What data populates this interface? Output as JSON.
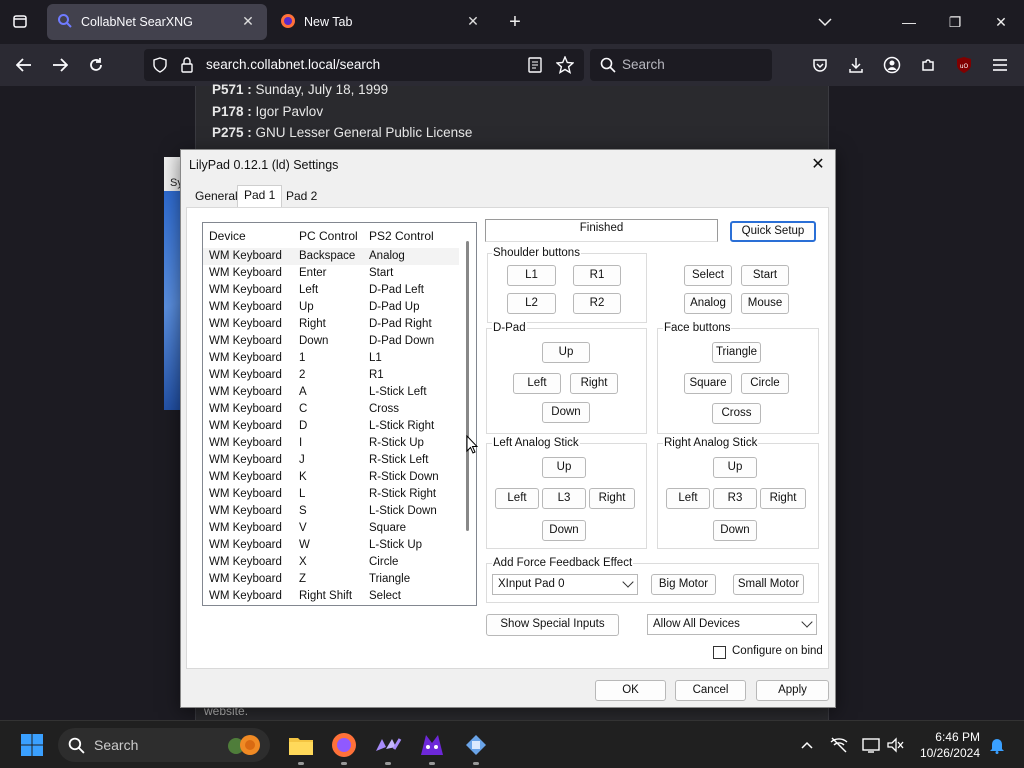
{
  "browser": {
    "tabs": [
      {
        "label": "CollabNet SearXNG",
        "active": true
      },
      {
        "label": "New Tab",
        "active": false
      }
    ],
    "url": "search.collabnet.local/search",
    "search_placeholder": "Search"
  },
  "page": {
    "properties": [
      {
        "key": "P571 :",
        "value": " Sunday, July 18, 1999"
      },
      {
        "key": "P178 :",
        "value": " Igor Pavlov"
      },
      {
        "key": "P275 :",
        "value": " GNU Lesser General Public License"
      }
    ],
    "partial_left": "Sy",
    "footer_text": "website."
  },
  "dialog": {
    "title": "LilyPad 0.12.1 (ld) Settings",
    "tabs": [
      "General",
      "Pad 1",
      "Pad 2"
    ],
    "selected_tab": "Pad 1",
    "list": {
      "columns": [
        "Device",
        "PC Control",
        "PS2 Control"
      ],
      "rows": [
        [
          "WM Keyboard",
          "Backspace",
          "Analog"
        ],
        [
          "WM Keyboard",
          "Enter",
          "Start"
        ],
        [
          "WM Keyboard",
          "Left",
          "D-Pad Left"
        ],
        [
          "WM Keyboard",
          "Up",
          "D-Pad Up"
        ],
        [
          "WM Keyboard",
          "Right",
          "D-Pad Right"
        ],
        [
          "WM Keyboard",
          "Down",
          "D-Pad Down"
        ],
        [
          "WM Keyboard",
          "1",
          "L1"
        ],
        [
          "WM Keyboard",
          "2",
          "R1"
        ],
        [
          "WM Keyboard",
          "A",
          "L-Stick Left"
        ],
        [
          "WM Keyboard",
          "C",
          "Cross"
        ],
        [
          "WM Keyboard",
          "D",
          "L-Stick Right"
        ],
        [
          "WM Keyboard",
          "I",
          "R-Stick Up"
        ],
        [
          "WM Keyboard",
          "J",
          "R-Stick Left"
        ],
        [
          "WM Keyboard",
          "K",
          "R-Stick Down"
        ],
        [
          "WM Keyboard",
          "L",
          "R-Stick Right"
        ],
        [
          "WM Keyboard",
          "S",
          "L-Stick Down"
        ],
        [
          "WM Keyboard",
          "V",
          "Square"
        ],
        [
          "WM Keyboard",
          "W",
          "L-Stick Up"
        ],
        [
          "WM Keyboard",
          "X",
          "Circle"
        ],
        [
          "WM Keyboard",
          "Z",
          "Triangle"
        ],
        [
          "WM Keyboard",
          "Right Shift",
          "Select"
        ]
      ]
    },
    "status": "Finished",
    "quick_setup": "Quick Setup",
    "shoulder": {
      "label": "Shoulder buttons",
      "l1": "L1",
      "r1": "R1",
      "l2": "L2",
      "r2": "R2"
    },
    "misc": {
      "select": "Select",
      "start": "Start",
      "analog": "Analog",
      "mouse": "Mouse"
    },
    "dpad": {
      "label": "D-Pad",
      "up": "Up",
      "left": "Left",
      "right": "Right",
      "down": "Down"
    },
    "face": {
      "label": "Face buttons",
      "triangle": "Triangle",
      "square": "Square",
      "circle": "Circle",
      "cross": "Cross"
    },
    "left_stick": {
      "label": "Left Analog Stick",
      "up": "Up",
      "left": "Left",
      "l3": "L3",
      "right": "Right",
      "down": "Down"
    },
    "right_stick": {
      "label": "Right Analog Stick",
      "up": "Up",
      "left": "Left",
      "r3": "R3",
      "right": "Right",
      "down": "Down"
    },
    "ff": {
      "label": "Add Force Feedback Effect",
      "device": "XInput Pad 0",
      "big": "Big Motor",
      "small": "Small Motor"
    },
    "show_special": "Show Special Inputs",
    "device_filter": "Allow All Devices",
    "configure_on_bind": "Configure on bind",
    "ok": "OK",
    "cancel": "Cancel",
    "apply": "Apply"
  },
  "taskbar": {
    "search_placeholder": "Search",
    "time": "6:46 PM",
    "date": "10/26/2024"
  }
}
